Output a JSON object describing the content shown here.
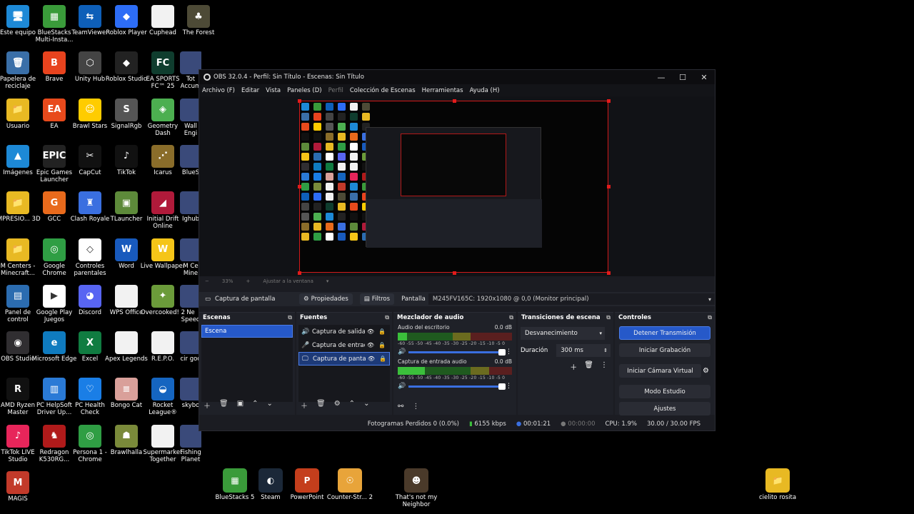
{
  "desktop": {
    "icons": [
      {
        "label": "Este equipo",
        "glyph": "🖥",
        "color": "#1d89d6"
      },
      {
        "label": "BlueStacks Multi-Insta...",
        "glyph": "▦",
        "color": "#3a9b3a"
      },
      {
        "label": "TeamViewer",
        "glyph": "⇆",
        "color": "#0e5fb8"
      },
      {
        "label": "Roblox Player",
        "glyph": "◆",
        "color": "#2d6df6"
      },
      {
        "label": "Cuphead",
        "glyph": "",
        "color": "#f2f2f2"
      },
      {
        "label": "The Forest",
        "glyph": "♣",
        "color": "#4d4a36"
      },
      {
        "label": "Papelera de reciclaje",
        "glyph": "🗑",
        "color": "#3a6fa8"
      },
      {
        "label": "Brave",
        "glyph": "B",
        "color": "#e8431e"
      },
      {
        "label": "Unity Hub",
        "glyph": "⬡",
        "color": "#444"
      },
      {
        "label": "Roblox Studio",
        "glyph": "◆",
        "color": "#222"
      },
      {
        "label": "EA SPORTS FC™ 25",
        "glyph": "FC",
        "color": "#0f3d2e"
      },
      {
        "label": "Usuario",
        "glyph": "📁",
        "color": "#e8b923"
      },
      {
        "label": "EA",
        "glyph": "EA",
        "color": "#e84a1c"
      },
      {
        "label": "Brawl Stars",
        "glyph": "☺",
        "color": "#ffcc00"
      },
      {
        "label": "SignalRgb",
        "glyph": "S",
        "color": "#555"
      },
      {
        "label": "Geometry Dash",
        "glyph": "◈",
        "color": "#4caf50"
      },
      {
        "label": "Imágenes",
        "glyph": "▲",
        "color": "#1d89d6"
      },
      {
        "label": "Epic Games Launcher",
        "glyph": "EPIC",
        "color": "#222"
      },
      {
        "label": "CapCut",
        "glyph": "✂",
        "color": "#111"
      },
      {
        "label": "TikTok",
        "glyph": "♪",
        "color": "#111"
      },
      {
        "label": "Icarus",
        "glyph": "⋰",
        "color": "#8a6d2a"
      },
      {
        "label": "IMPRESIO... 3D",
        "glyph": "📁",
        "color": "#e8b923"
      },
      {
        "label": "GCC",
        "glyph": "G",
        "color": "#e86a1c"
      },
      {
        "label": "Clash Royale",
        "glyph": "♜",
        "color": "#3a6fe0"
      },
      {
        "label": "TLauncher",
        "glyph": "▣",
        "color": "#5d8a3a"
      },
      {
        "label": "Initial Drift Online",
        "glyph": "◢",
        "color": "#b01a3a"
      },
      {
        "label": "M Centers - Minecraft...",
        "glyph": "📁",
        "color": "#e8b923"
      },
      {
        "label": "Google Chrome",
        "glyph": "◎",
        "color": "#2f9e44"
      },
      {
        "label": "Controles parentales",
        "glyph": "◇",
        "color": "#fff"
      },
      {
        "label": "Word",
        "glyph": "W",
        "color": "#185abd"
      },
      {
        "label": "Live Wallpaper",
        "glyph": "W",
        "color": "#f5c518"
      },
      {
        "label": "Panel de control",
        "glyph": "▤",
        "color": "#2b6cb0"
      },
      {
        "label": "Google Play Juegos",
        "glyph": "▶",
        "color": "#fff"
      },
      {
        "label": "Discord",
        "glyph": "◕",
        "color": "#5865f2"
      },
      {
        "label": "WPS Office",
        "glyph": "",
        "color": "#f2f2f2"
      },
      {
        "label": "Overcooked! 2",
        "glyph": "✦",
        "color": "#6b9b3a"
      },
      {
        "label": "OBS Studio",
        "glyph": "◉",
        "color": "#302e31"
      },
      {
        "label": "Microsoft Edge",
        "glyph": "e",
        "color": "#0f7bbf"
      },
      {
        "label": "Excel",
        "glyph": "X",
        "color": "#107c41"
      },
      {
        "label": "Apex Legends",
        "glyph": "",
        "color": "#f2f2f2"
      },
      {
        "label": "R.E.P.O.",
        "glyph": "",
        "color": "#f2f2f2"
      },
      {
        "label": "AMD Ryzen Master",
        "glyph": "R",
        "color": "#111"
      },
      {
        "label": "PC HelpSoft Driver Up...",
        "glyph": "▥",
        "color": "#2a7ad6"
      },
      {
        "label": "PC Health Check",
        "glyph": "♡",
        "color": "#1a7ee6"
      },
      {
        "label": "Bongo Cat",
        "glyph": "≡",
        "color": "#d9a09a"
      },
      {
        "label": "Rocket League®",
        "glyph": "◒",
        "color": "#1565c0"
      },
      {
        "label": "TikTok LIVE Studio",
        "glyph": "♪",
        "color": "#e7255a"
      },
      {
        "label": "Redragon K530RG...",
        "glyph": "♞",
        "color": "#b01a1a"
      },
      {
        "label": "Persona 1 - Chrome",
        "glyph": "◎",
        "color": "#2f9e44"
      },
      {
        "label": "Brawlhalla",
        "glyph": "☗",
        "color": "#7a8a3a"
      },
      {
        "label": "Supermarket Together",
        "glyph": "",
        "color": "#f2f2f2"
      },
      {
        "label": "MAGIS",
        "glyph": "M",
        "color": "#c23a2a"
      }
    ],
    "partial_labels": [
      "Tot Accum",
      "Wall Engi",
      "BlueS",
      "Ighub",
      "M Ce Mine",
      "Ne Speed",
      "cir goo",
      "skybo",
      "Fishing Planet"
    ],
    "bottom_icons": [
      {
        "label": "BlueStacks 5",
        "glyph": "▦",
        "color": "#3a9b3a"
      },
      {
        "label": "Steam",
        "glyph": "◐",
        "color": "#1b2838"
      },
      {
        "label": "PowerPoint",
        "glyph": "P",
        "color": "#c43e1c"
      },
      {
        "label": "Counter-Str... 2",
        "glyph": "☉",
        "color": "#e8a43a"
      },
      {
        "label": "That's not my Neighbor",
        "glyph": "☻",
        "color": "#4a3a2a"
      },
      {
        "label": "cielito rosita",
        "glyph": "📁",
        "color": "#e8b923"
      }
    ]
  },
  "obs": {
    "title": "OBS 32.0.4 - Perfil: Sin Título - Escenas: Sin Título",
    "window_controls": [
      "—",
      "☐",
      "✕"
    ],
    "menu": [
      "Archivo (F)",
      "Editar",
      "Vista",
      "Paneles (D)",
      "Perfil",
      "Colección de Escenas",
      "Herramientas",
      "Ayuda (H)"
    ],
    "zoom": {
      "minus": "−",
      "percent": "33%",
      "plus": "+",
      "fit": "Ajustar a la ventana"
    },
    "source_bar": {
      "source": "Captura de pantalla",
      "properties": "Propiedades",
      "filters": "Filtros",
      "field_label": "Pantalla",
      "field_value": "M245FV165C: 1920x1080 @ 0,0 (Monitor principal)"
    },
    "scenes": {
      "title": "Escenas",
      "items": [
        "Escena"
      ]
    },
    "sources": {
      "title": "Fuentes",
      "items": [
        {
          "icon": "🔊",
          "name": "Captura de salida"
        },
        {
          "icon": "🎤",
          "name": "Captura de entrada"
        },
        {
          "icon": "🖵",
          "name": "Captura de pantalla"
        }
      ]
    },
    "mixer": {
      "title": "Mezclador de audio",
      "ticks": "-60 -55 -50 -45 -40 -35 -30 -25 -20 -15 -10 -5 0",
      "channels": [
        {
          "name": "Audio del escritorio",
          "db": "0.0 dB",
          "level": 0.0
        },
        {
          "name": "Captura de entrada audio",
          "db": "0.0 dB",
          "level": 0.4
        }
      ]
    },
    "transitions": {
      "title": "Transiciones de escena",
      "selected": "Desvanecimiento",
      "duration_label": "Duración",
      "duration_value": "300 ms"
    },
    "controls": {
      "title": "Controles",
      "buttons": [
        "Detener Transmisión",
        "Iniciar Grabación",
        "Iniciar Cámara Virtual",
        "Modo Estudio",
        "Ajustes"
      ]
    },
    "status": {
      "dropped": "Fotogramas Perdidos 0 (0.0%)",
      "bitrate": "6155 kbps",
      "stream_time": "00:01:21",
      "rec_time": "00:00:00",
      "cpu": "CPU: 1.9%",
      "fps": "30.00 / 30.00 FPS"
    }
  }
}
